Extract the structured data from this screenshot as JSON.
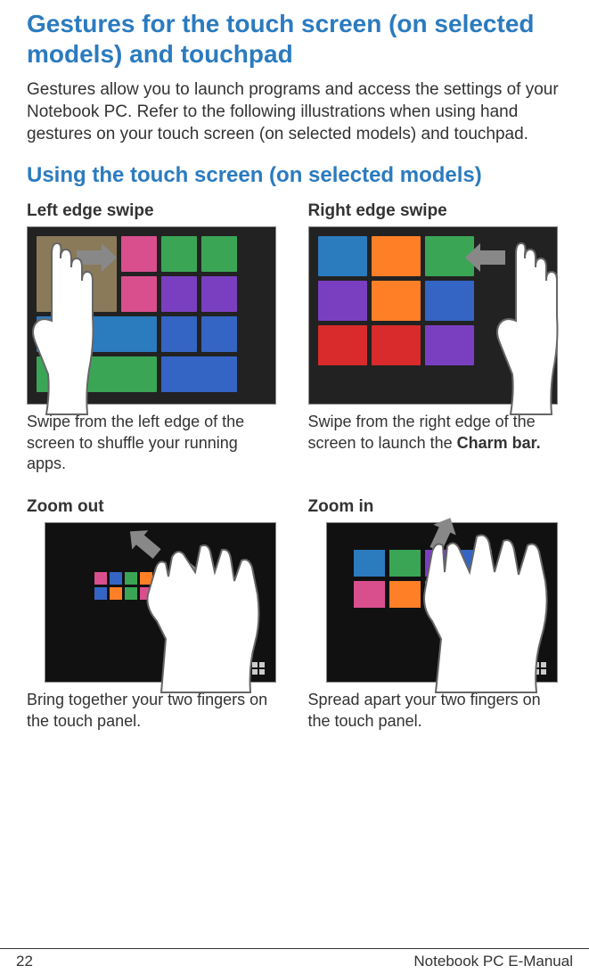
{
  "heading": "Gestures for the touch screen (on selected models) and touchpad",
  "intro": "Gestures allow you to launch programs and access the settings of your Notebook PC. Refer to the following illustrations when using hand gestures on your touch screen (on selected models) and touchpad.",
  "subheading": "Using the touch screen (on selected models)",
  "gestures": {
    "left_edge": {
      "title": "Left edge swipe",
      "desc": "Swipe from the left edge of the screen to shuffle your running apps."
    },
    "right_edge": {
      "title": "Right edge swipe",
      "desc_pre": "Swipe from the right edge of the screen to launch the ",
      "desc_bold": "Charm bar."
    },
    "zoom_out": {
      "title": "Zoom out",
      "desc": "Bring together your two fingers on the touch panel."
    },
    "zoom_in": {
      "title": "Zoom in",
      "desc": "Spread apart your two fingers on the touch panel."
    }
  },
  "footer": {
    "page": "22",
    "label": "Notebook PC E-Manual"
  }
}
